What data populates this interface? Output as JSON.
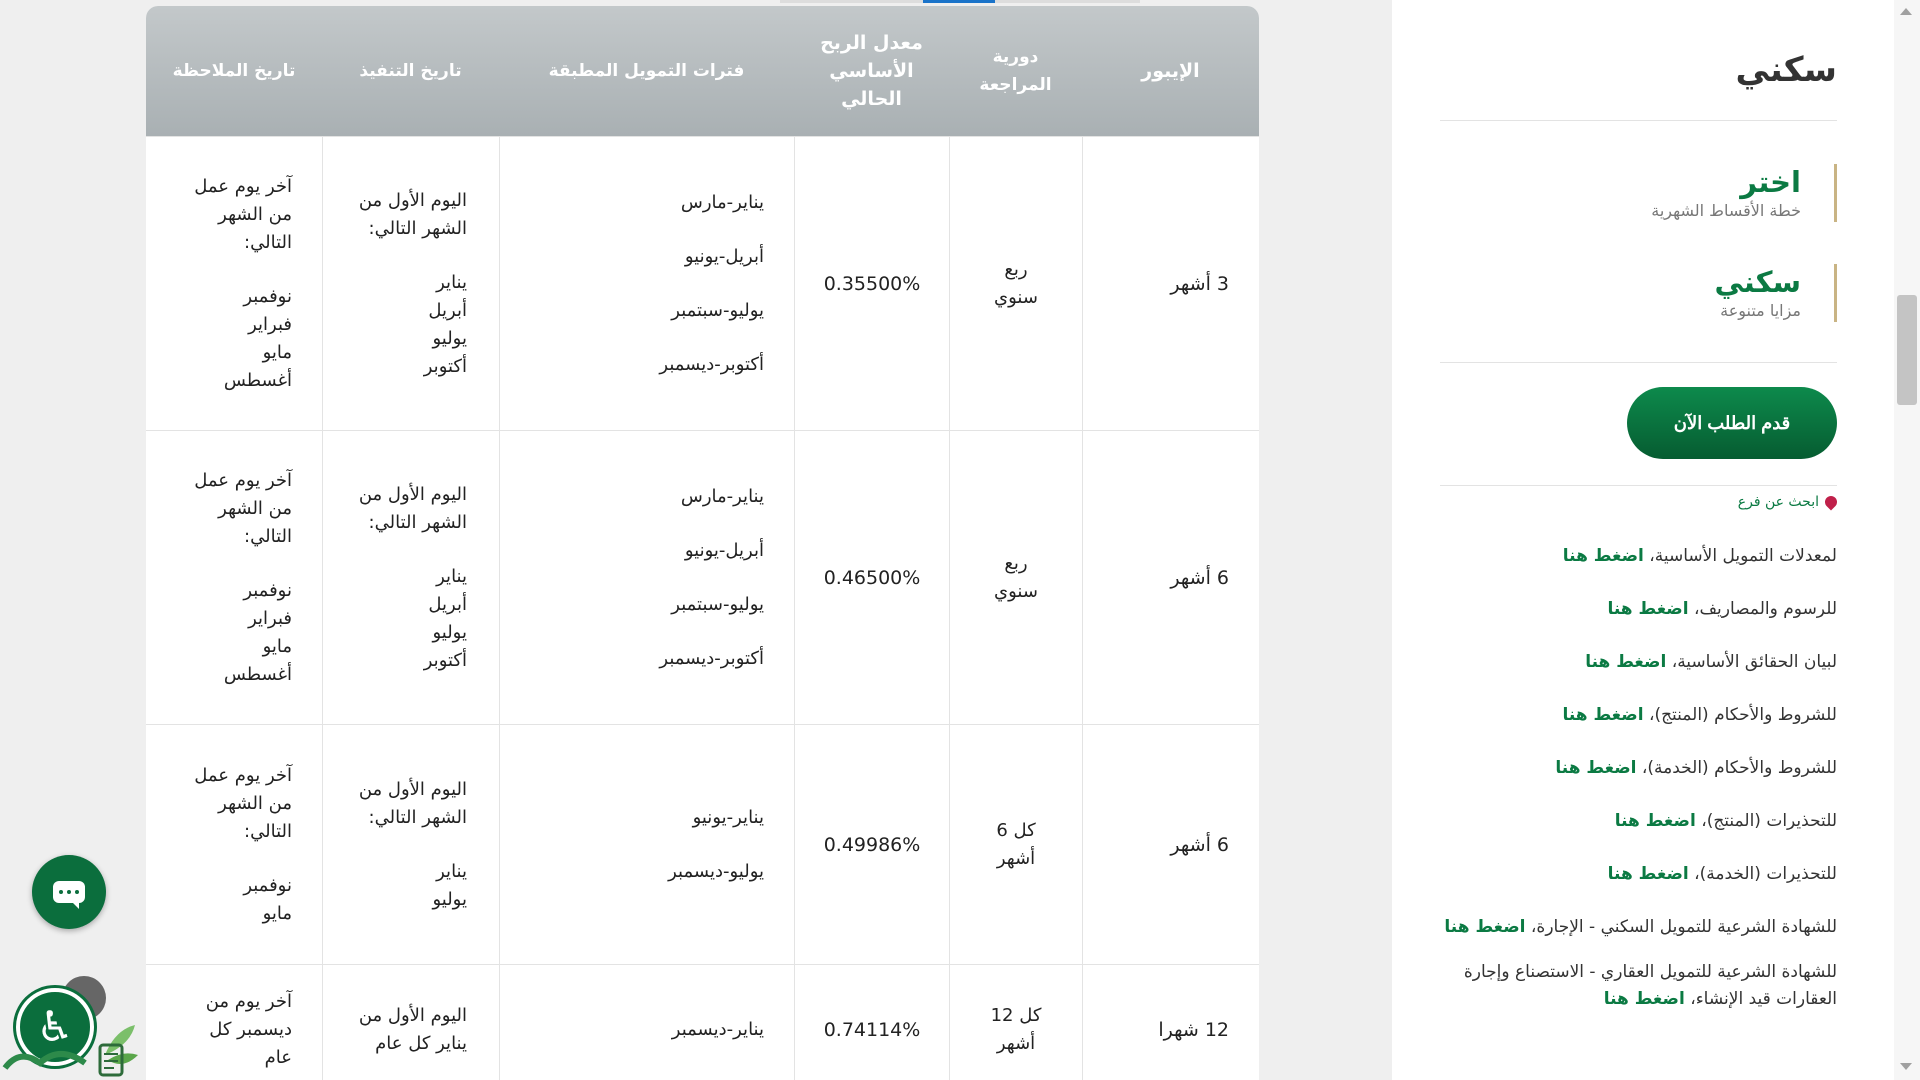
{
  "table": {
    "headers": {
      "ibor": "الإيبور",
      "review_frequency": "دورية المراجعة",
      "base_rate": "معدل الربح الأساسي الحالي",
      "financing_periods": "فترات التمويل المطبقة",
      "execution_date": "تاريخ التنفيذ",
      "observation_date": "تاريخ الملاحظة"
    },
    "rows": [
      {
        "ibor": "3 أشهر",
        "frequency": [
          "ربع",
          "سنوي"
        ],
        "rate": "0.35500%",
        "periods": [
          "يناير-مارس",
          "أبريل-يونيو",
          "يوليو-سبتمبر",
          "أكتوبر-ديسمبر"
        ],
        "execution": [
          "اليوم الأول من",
          "الشهر التالي:",
          "",
          "يناير",
          "أبريل",
          "يوليو",
          "أكتوبر"
        ],
        "observation": [
          "آخر يوم عمل",
          "من الشهر",
          "التالي:",
          "",
          "نوفمبر",
          "فبراير",
          "مايو",
          "أغسطس"
        ]
      },
      {
        "ibor": "6 أشهر",
        "frequency": [
          "ربع",
          "سنوي"
        ],
        "rate": "0.46500%",
        "periods": [
          "يناير-مارس",
          "أبريل-يونيو",
          "يوليو-سبتمبر",
          "أكتوبر-ديسمبر"
        ],
        "execution": [
          "اليوم الأول من",
          "الشهر التالي:",
          "",
          "يناير",
          "أبريل",
          "يوليو",
          "أكتوبر"
        ],
        "observation": [
          "آخر يوم عمل",
          "من الشهر",
          "التالي:",
          "",
          "نوفمبر",
          "فبراير",
          "مايو",
          "أغسطس"
        ]
      },
      {
        "ibor": "6 أشهر",
        "frequency": [
          "كل 6",
          "أشهر"
        ],
        "rate": "0.49986%",
        "periods": [
          "يناير-يونيو",
          "يوليو-ديسمبر"
        ],
        "execution": [
          "اليوم الأول من",
          "الشهر التالي:",
          "",
          "يناير",
          "يوليو"
        ],
        "observation": [
          "آخر يوم عمل",
          "من الشهر",
          "التالي:",
          "",
          "نوفمبر",
          "مايو"
        ]
      },
      {
        "ibor": "12 شهرا",
        "frequency": [
          "كل 12",
          "أشهر"
        ],
        "rate": "0.74114%",
        "periods": [
          "يناير-ديسمبر"
        ],
        "execution": [
          "اليوم الأول من",
          "يناير كل عام"
        ],
        "observation": [
          "آخر يوم من",
          "ديسمبر كل",
          "عام"
        ]
      }
    ]
  },
  "sidebar": {
    "product_title": "سكني",
    "choices": [
      {
        "title": "اختر",
        "subtitle": "خطة الأقساط الشهرية"
      },
      {
        "title": "سكني",
        "subtitle": "مزايا متنوعة"
      }
    ],
    "apply_label": "قدم الطلب الآن",
    "branch_label": "ابحث عن فرع",
    "link_word": "اضغط هنا",
    "links": [
      "لمعدلات التمويل الأساسية،",
      "للرسوم والمصاريف،",
      "لبيان الحقائق الأساسية،",
      "للشروط والأحكام (المنتج)،",
      "للشروط والأحكام (الخدمة)،",
      "للتحذيرات (المنتج)،",
      "للتحذيرات (الخدمة)،",
      "للشهادة الشرعية للتمويل السكني - الإجارة،",
      "للشهادة الشرعية للتمويل العقاري - الاستصناع وإجارة العقارات قيد الإنشاء،"
    ]
  },
  "icons": {
    "chat": "chat-bubble-icon",
    "accessibility": "wheelchair-icon",
    "pin": "map-pin-icon"
  },
  "colors": {
    "brand_green": "#0b7a43",
    "header_gray": "#b2b8bb",
    "accent_gold": "#c9b484"
  }
}
